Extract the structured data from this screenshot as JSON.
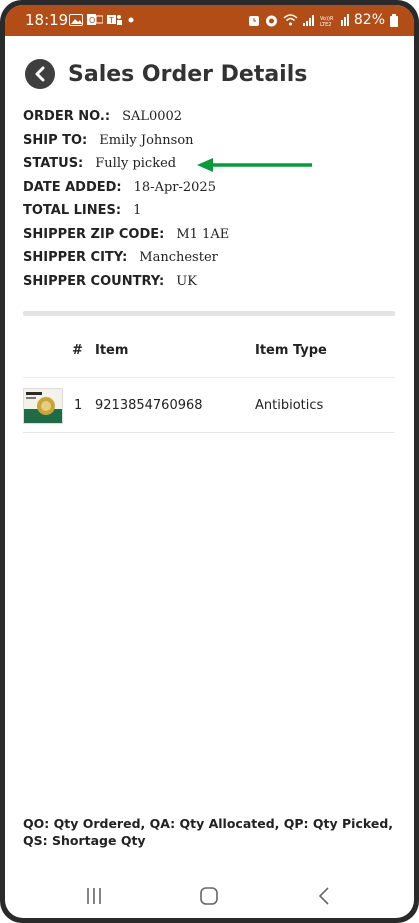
{
  "statusbar": {
    "time": "18:19",
    "left_icons": [
      "gallery-icon",
      "outlook-icon",
      "teams-icon",
      "dot-icon"
    ],
    "right_icons": [
      "alarm-icon",
      "do-not-disturb-icon",
      "wifi-icon",
      "signal-icon",
      "volte-icon",
      "signal-icon-2",
      "battery-icon"
    ],
    "volte_label": "Vo)) R LTE2",
    "battery": "82%"
  },
  "header": {
    "title": "Sales Order Details",
    "back_icon": "chevron-left-icon"
  },
  "details": [
    {
      "label": "ORDER NO.:",
      "value": "SAL0002"
    },
    {
      "label": "SHIP TO:",
      "value": "Emily  Johnson"
    },
    {
      "label": "STATUS:",
      "value": "Fully picked"
    },
    {
      "label": "DATE ADDED:",
      "value": "18-Apr-2025"
    },
    {
      "label": "TOTAL LINES:",
      "value": "1"
    },
    {
      "label": "SHIPPER ZIP CODE:",
      "value": "M1 1AE"
    },
    {
      "label": "SHIPPER CITY:",
      "value": "Manchester"
    },
    {
      "label": "SHIPPER COUNTRY:",
      "value": "UK"
    }
  ],
  "annotation": {
    "arrow_color": "#0a9a3c",
    "points_to": "STATUS"
  },
  "table": {
    "columns": [
      "#",
      "Item",
      "Item Type"
    ],
    "rows": [
      {
        "index": "1",
        "item": "9213854760968",
        "item_type": "Antibiotics",
        "thumb_text": "aVALEXie"
      }
    ]
  },
  "legend": "QO: Qty Ordered, QA: Qty Allocated, QP: Qty Picked, QS: Shortage Qty",
  "navbar": [
    "recent-apps-icon",
    "home-icon",
    "back-icon"
  ],
  "colors": {
    "statusbar": "#b34d17",
    "accent_arrow": "#0a9a3c",
    "text": "#222222"
  }
}
